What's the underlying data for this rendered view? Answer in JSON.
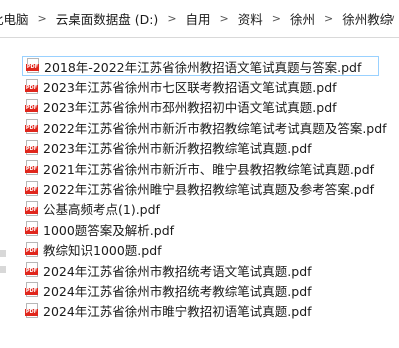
{
  "breadcrumb": {
    "items": [
      "此电脑",
      "云桌面数据盘 (D:)",
      "自用",
      "资料",
      "徐州",
      "徐州教综"
    ]
  },
  "files": [
    "2018年-2022年江苏省徐州教招语文笔试真题与答案.pdf",
    "2023年江苏省徐州市七区联考教招语文笔试真题.pdf",
    "2023年江苏省徐州市邳州教招初中语文笔试真题.pdf",
    "2022年江苏省徐州市新沂市教招教综笔试考试真题及答案.pdf",
    "2023年江苏省徐州市新沂教招教综笔试真题.pdf",
    "2021年江苏省徐州市新沂市、睢宁县教招教综笔试真题.pdf",
    "2022年江苏省徐州睢宁县教招教综笔试真题及参考答案.pdf",
    "公基高频考点(1).pdf",
    "1000题答案及解析.pdf",
    "教综知识1000题.pdf",
    "2024年江苏省徐州市教招统考语文笔试真题.pdf",
    "2024年江苏省徐州市教招统考教综笔试真题.pdf",
    "2024年江苏省徐州市睢宁教招初语笔试真题.pdf"
  ],
  "icons": {
    "file": "pdf-file-icon",
    "dropdown": "chevron-down-icon"
  },
  "colors": {
    "pdf_red": "#e0261c",
    "selection_border": "#99d1ff"
  }
}
